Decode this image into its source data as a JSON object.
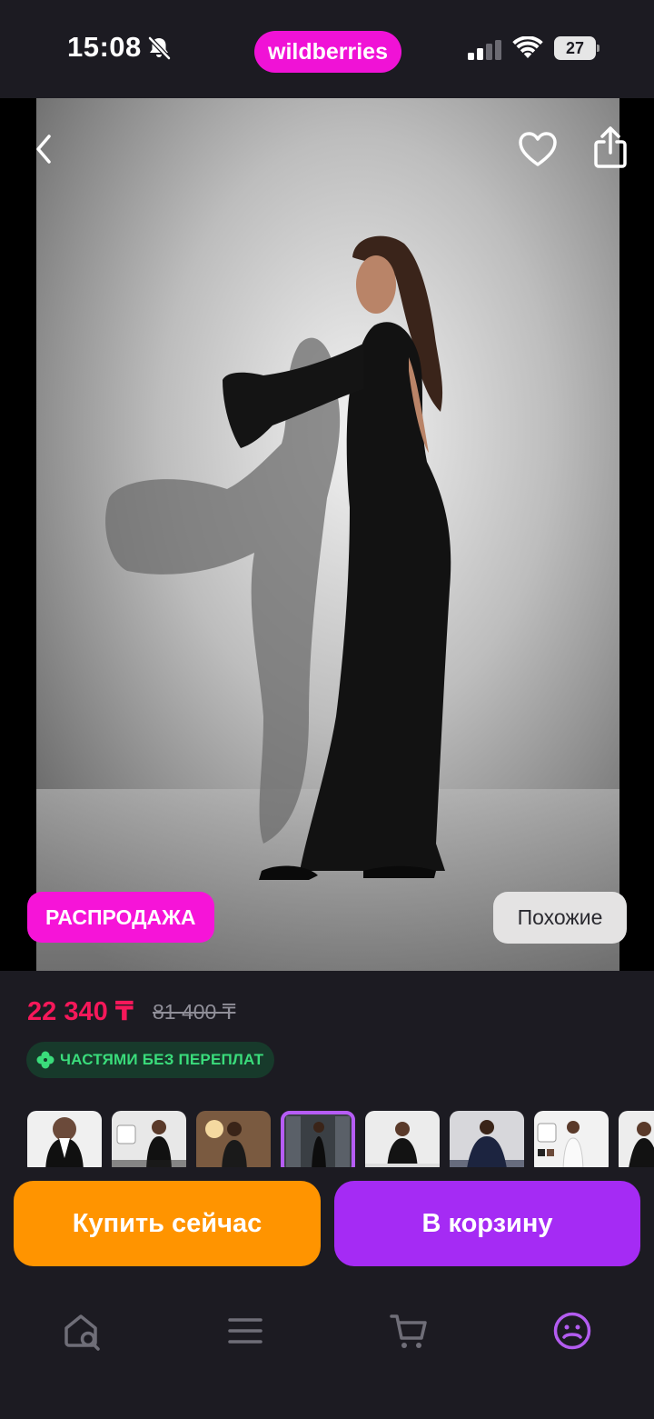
{
  "status_bar": {
    "time": "15:08",
    "battery": "27",
    "icons": [
      "bell-slash-icon",
      "cellular-signal-icon",
      "wifi-icon",
      "battery-icon"
    ]
  },
  "brand": {
    "logo_text": "wildberries",
    "color": "#f012d6"
  },
  "product": {
    "sale_badge": "РАСПРОДАЖА",
    "similar_button": "Похожие",
    "price": "22 340 ₸",
    "old_price": "81 400 ₸",
    "installment_label": "ЧАСТЯМИ БЕЗ ПЕРЕПЛАТ",
    "selected_thumbnail_index": 3
  },
  "actions": {
    "buy_now": "Купить сейчас",
    "add_to_cart": "В корзину"
  },
  "tabbar": {
    "items": [
      "home-search-icon",
      "menu-icon",
      "cart-icon",
      "profile-icon"
    ],
    "active": "profile-icon"
  },
  "colors": {
    "background": "#1c1b22",
    "price": "#f6185a",
    "sale": "#f614d8",
    "buy_now": "#ff9400",
    "add_to_cart": "#a52bf4",
    "installment_text": "#3adc7b",
    "active_tab": "#b35cf0"
  }
}
